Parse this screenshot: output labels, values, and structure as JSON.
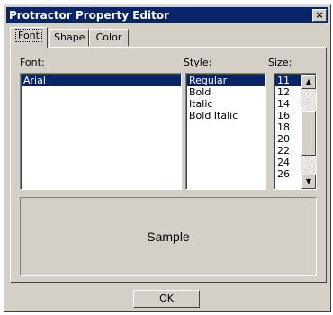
{
  "window": {
    "title": "Protractor Property Editor",
    "close_label": "×"
  },
  "tabs": [
    {
      "label": "Font",
      "active": true
    },
    {
      "label": "Shape",
      "active": false
    },
    {
      "label": "Color",
      "active": false
    }
  ],
  "font": {
    "label": "Font:",
    "items": [
      "Arial"
    ],
    "selected": "Arial"
  },
  "style": {
    "label": "Style:",
    "items": [
      "Regular",
      "Bold",
      "Italic",
      "Bold Italic"
    ],
    "selected": "Regular"
  },
  "size": {
    "label": "Size:",
    "items": [
      "11",
      "12",
      "14",
      "16",
      "18",
      "20",
      "22",
      "24",
      "26"
    ],
    "selected": "11"
  },
  "sample": {
    "text": "Sample"
  },
  "ok_label": "OK",
  "colors": {
    "titlebar": "#0a246a",
    "face": "#d4d0c8",
    "selection": "#0a246a"
  }
}
